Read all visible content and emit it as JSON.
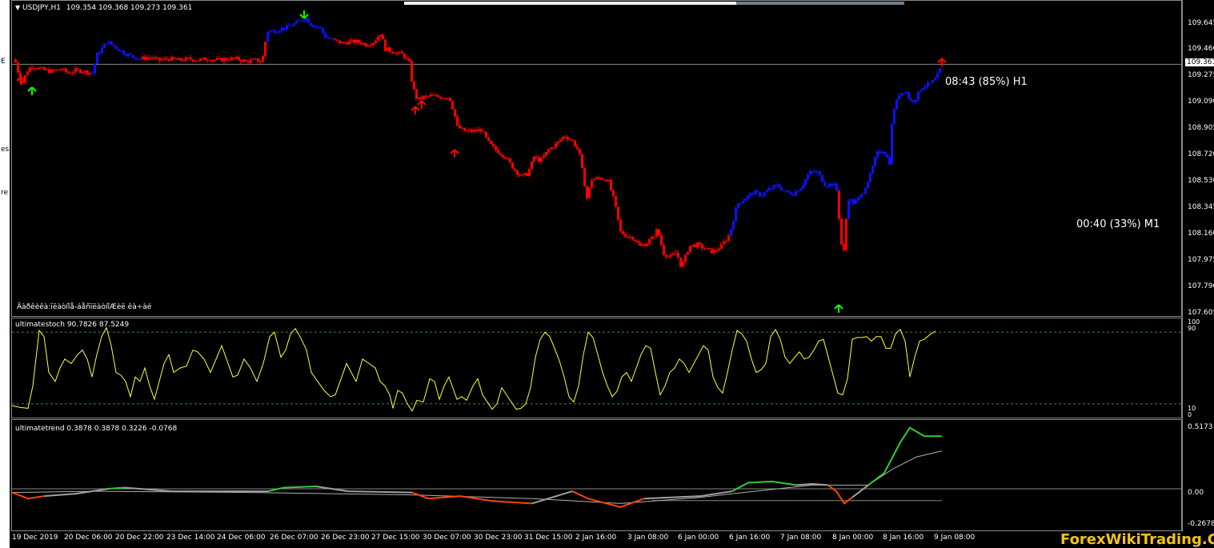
{
  "symbol_info": {
    "label": "USDJPY,H1",
    "ohlc": "109.354 109.368 109.273 109.361",
    "dropdown_icon": "triangle-down-icon"
  },
  "left_strip_glyphs": [
    "E",
    "es",
    "re"
  ],
  "price_axis": {
    "ticks": [
      "109.645",
      "109.460",
      "109.275",
      "109.090",
      "108.905",
      "108.720",
      "108.530",
      "108.345",
      "108.160",
      "107.975",
      "107.790",
      "107.605"
    ],
    "current_price": "109.361"
  },
  "overlays": {
    "timer_h1": "08:43 (85%) H1",
    "timer_m1": "00:40 (33%) M1",
    "garbled_caption": "Äàðêèêà:ïëàòíîå-áåñïëàòíîÆèë êà÷àé"
  },
  "stoch_pane": {
    "title": "ultimatestoch 90.7826 87.5249",
    "ticks": [
      "100",
      "90",
      "10",
      "0"
    ],
    "line_color": "#ffff33"
  },
  "trend_pane": {
    "title": "ultimatetrend 0.3878 0.3878 0.3226 -0.0768",
    "ticks": [
      "0.5173",
      "0.00",
      "-0.2678"
    ],
    "colors": {
      "up": "#33cc33",
      "down": "#ff4500",
      "neutral": "#a0a0a0"
    }
  },
  "time_axis": [
    "19 Dec 2019",
    "20 Dec 06:00",
    "20 Dec 22:00",
    "23 Dec 14:00",
    "24 Dec 06:00",
    "26 Dec 07:00",
    "26 Dec 23:00",
    "27 Dec 15:00",
    "30 Dec 07:00",
    "30 Dec 23:00",
    "31 Dec 15:00",
    "2 Jan 16:00",
    "3 Jan 08:00",
    "6 Jan 00:00",
    "6 Jan 16:00",
    "7 Jan 08:00",
    "8 Jan 00:00",
    "8 Jan 16:00",
    "9 Jan 08:00"
  ],
  "watermark": "ForexWikiTrading.Com",
  "colors": {
    "bull": "#1010ff",
    "bear": "#ff0000",
    "arrow_up": "#00ff00",
    "arrow_down": "#ff0000",
    "background": "#000000",
    "grid_border": "#8a8a8a"
  },
  "price_path": [
    [
      0,
      109.46
    ],
    [
      6,
      109.33
    ],
    [
      12,
      109.22
    ],
    [
      18,
      109.31
    ],
    [
      24,
      109.35
    ],
    [
      30,
      109.34
    ],
    [
      40,
      109.32
    ],
    [
      50,
      109.31
    ],
    [
      60,
      109.33
    ],
    [
      70,
      109.3
    ],
    [
      80,
      109.32
    ],
    [
      90,
      109.31
    ],
    [
      100,
      109.3
    ],
    [
      106,
      109.43
    ],
    [
      112,
      109.47
    ],
    [
      118,
      109.52
    ],
    [
      124,
      109.5
    ],
    [
      132,
      109.47
    ],
    [
      140,
      109.44
    ],
    [
      148,
      109.42
    ],
    [
      160,
      109.4
    ],
    [
      172,
      109.41
    ],
    [
      184,
      109.39
    ],
    [
      196,
      109.4
    ],
    [
      208,
      109.39
    ],
    [
      220,
      109.4
    ],
    [
      232,
      109.39
    ],
    [
      244,
      109.4
    ],
    [
      256,
      109.39
    ],
    [
      268,
      109.4
    ],
    [
      280,
      109.4
    ],
    [
      292,
      109.38
    ],
    [
      304,
      109.39
    ],
    [
      312,
      109.38
    ],
    [
      318,
      109.59
    ],
    [
      330,
      109.6
    ],
    [
      342,
      109.62
    ],
    [
      354,
      109.65
    ],
    [
      366,
      109.69
    ],
    [
      374,
      109.64
    ],
    [
      384,
      109.62
    ],
    [
      392,
      109.55
    ],
    [
      402,
      109.53
    ],
    [
      412,
      109.51
    ],
    [
      422,
      109.52
    ],
    [
      432,
      109.52
    ],
    [
      442,
      109.5
    ],
    [
      452,
      109.52
    ],
    [
      460,
      109.58
    ],
    [
      466,
      109.47
    ],
    [
      476,
      109.45
    ],
    [
      488,
      109.43
    ],
    [
      496,
      109.37
    ],
    [
      500,
      109.21
    ],
    [
      506,
      109.11
    ],
    [
      514,
      109.13
    ],
    [
      524,
      109.14
    ],
    [
      534,
      109.13
    ],
    [
      546,
      109.13
    ],
    [
      552,
      109.02
    ],
    [
      556,
      108.92
    ],
    [
      566,
      108.89
    ],
    [
      576,
      108.89
    ],
    [
      586,
      108.9
    ],
    [
      596,
      108.8
    ],
    [
      606,
      108.75
    ],
    [
      616,
      108.71
    ],
    [
      626,
      108.63
    ],
    [
      636,
      108.57
    ],
    [
      644,
      108.59
    ],
    [
      652,
      108.71
    ],
    [
      660,
      108.68
    ],
    [
      670,
      108.76
    ],
    [
      680,
      108.8
    ],
    [
      690,
      108.86
    ],
    [
      700,
      108.82
    ],
    [
      708,
      108.75
    ],
    [
      714,
      108.55
    ],
    [
      718,
      108.42
    ],
    [
      724,
      108.55
    ],
    [
      734,
      108.56
    ],
    [
      744,
      108.55
    ],
    [
      752,
      108.4
    ],
    [
      760,
      108.18
    ],
    [
      768,
      108.15
    ],
    [
      776,
      108.14
    ],
    [
      784,
      108.08
    ],
    [
      792,
      108.1
    ],
    [
      800,
      108.14
    ],
    [
      806,
      108.2
    ],
    [
      814,
      108.03
    ],
    [
      822,
      108.0
    ],
    [
      830,
      108.04
    ],
    [
      836,
      107.93
    ],
    [
      846,
      108.08
    ],
    [
      856,
      108.09
    ],
    [
      866,
      108.06
    ],
    [
      876,
      108.04
    ],
    [
      886,
      108.08
    ],
    [
      896,
      108.16
    ],
    [
      906,
      108.38
    ],
    [
      916,
      108.42
    ],
    [
      926,
      108.46
    ],
    [
      936,
      108.44
    ],
    [
      946,
      108.48
    ],
    [
      956,
      108.51
    ],
    [
      966,
      108.46
    ],
    [
      976,
      108.45
    ],
    [
      986,
      108.5
    ],
    [
      996,
      108.6
    ],
    [
      1006,
      108.6
    ],
    [
      1016,
      108.51
    ],
    [
      1026,
      108.52
    ],
    [
      1030,
      108.47
    ],
    [
      1034,
      108.22
    ],
    [
      1038,
      107.97
    ],
    [
      1044,
      108.42
    ],
    [
      1052,
      108.38
    ],
    [
      1062,
      108.45
    ],
    [
      1072,
      108.58
    ],
    [
      1080,
      108.73
    ],
    [
      1088,
      108.76
    ],
    [
      1096,
      108.67
    ],
    [
      1100,
      109.02
    ],
    [
      1108,
      109.15
    ],
    [
      1116,
      109.18
    ],
    [
      1122,
      109.1
    ],
    [
      1128,
      109.11
    ],
    [
      1136,
      109.2
    ],
    [
      1146,
      109.22
    ],
    [
      1154,
      109.26
    ],
    [
      1162,
      109.36
    ]
  ],
  "stoch_path": [
    [
      0,
      8
    ],
    [
      10,
      6
    ],
    [
      20,
      5
    ],
    [
      26,
      30
    ],
    [
      34,
      92
    ],
    [
      40,
      85
    ],
    [
      46,
      45
    ],
    [
      54,
      35
    ],
    [
      60,
      50
    ],
    [
      66,
      60
    ],
    [
      74,
      55
    ],
    [
      82,
      65
    ],
    [
      88,
      70
    ],
    [
      94,
      60
    ],
    [
      100,
      40
    ],
    [
      106,
      65
    ],
    [
      112,
      85
    ],
    [
      118,
      95
    ],
    [
      124,
      75
    ],
    [
      130,
      45
    ],
    [
      136,
      42
    ],
    [
      142,
      35
    ],
    [
      148,
      18
    ],
    [
      154,
      40
    ],
    [
      160,
      35
    ],
    [
      166,
      50
    ],
    [
      172,
      30
    ],
    [
      178,
      15
    ],
    [
      184,
      35
    ],
    [
      190,
      55
    ],
    [
      196,
      65
    ],
    [
      202,
      45
    ],
    [
      210,
      50
    ],
    [
      218,
      52
    ],
    [
      226,
      70
    ],
    [
      232,
      68
    ],
    [
      240,
      60
    ],
    [
      248,
      45
    ],
    [
      256,
      62
    ],
    [
      262,
      75
    ],
    [
      268,
      60
    ],
    [
      276,
      40
    ],
    [
      282,
      42
    ],
    [
      290,
      60
    ],
    [
      298,
      50
    ],
    [
      306,
      35
    ],
    [
      314,
      55
    ],
    [
      322,
      85
    ],
    [
      328,
      90
    ],
    [
      336,
      62
    ],
    [
      342,
      70
    ],
    [
      348,
      88
    ],
    [
      354,
      94
    ],
    [
      360,
      85
    ],
    [
      368,
      70
    ],
    [
      374,
      45
    ],
    [
      382,
      35
    ],
    [
      390,
      25
    ],
    [
      398,
      18
    ],
    [
      404,
      20
    ],
    [
      412,
      40
    ],
    [
      418,
      55
    ],
    [
      424,
      45
    ],
    [
      430,
      35
    ],
    [
      438,
      60
    ],
    [
      446,
      55
    ],
    [
      454,
      50
    ],
    [
      460,
      35
    ],
    [
      466,
      30
    ],
    [
      472,
      20
    ],
    [
      476,
      5
    ],
    [
      482,
      25
    ],
    [
      488,
      22
    ],
    [
      494,
      10
    ],
    [
      500,
      2
    ],
    [
      506,
      14
    ],
    [
      514,
      12
    ],
    [
      522,
      38
    ],
    [
      528,
      35
    ],
    [
      534,
      15
    ],
    [
      540,
      30
    ],
    [
      546,
      40
    ],
    [
      552,
      25
    ],
    [
      556,
      15
    ],
    [
      562,
      18
    ],
    [
      568,
      14
    ],
    [
      576,
      30
    ],
    [
      582,
      38
    ],
    [
      588,
      20
    ],
    [
      594,
      12
    ],
    [
      600,
      4
    ],
    [
      606,
      10
    ],
    [
      612,
      28
    ],
    [
      618,
      20
    ],
    [
      624,
      12
    ],
    [
      630,
      4
    ],
    [
      636,
      5
    ],
    [
      642,
      10
    ],
    [
      648,
      28
    ],
    [
      654,
      62
    ],
    [
      660,
      82
    ],
    [
      666,
      90
    ],
    [
      672,
      85
    ],
    [
      678,
      72
    ],
    [
      684,
      58
    ],
    [
      690,
      40
    ],
    [
      696,
      18
    ],
    [
      702,
      12
    ],
    [
      708,
      30
    ],
    [
      714,
      65
    ],
    [
      720,
      90
    ],
    [
      726,
      84
    ],
    [
      732,
      65
    ],
    [
      738,
      45
    ],
    [
      744,
      30
    ],
    [
      750,
      18
    ],
    [
      756,
      24
    ],
    [
      762,
      40
    ],
    [
      768,
      45
    ],
    [
      774,
      35
    ],
    [
      780,
      50
    ],
    [
      786,
      65
    ],
    [
      792,
      75
    ],
    [
      798,
      72
    ],
    [
      804,
      45
    ],
    [
      810,
      20
    ],
    [
      816,
      30
    ],
    [
      822,
      45
    ],
    [
      828,
      50
    ],
    [
      834,
      60
    ],
    [
      840,
      55
    ],
    [
      846,
      45
    ],
    [
      852,
      55
    ],
    [
      858,
      65
    ],
    [
      864,
      75
    ],
    [
      870,
      70
    ],
    [
      876,
      40
    ],
    [
      882,
      28
    ],
    [
      888,
      22
    ],
    [
      894,
      45
    ],
    [
      900,
      70
    ],
    [
      906,
      92
    ],
    [
      912,
      88
    ],
    [
      918,
      80
    ],
    [
      924,
      60
    ],
    [
      930,
      45
    ],
    [
      936,
      48
    ],
    [
      942,
      55
    ],
    [
      948,
      85
    ],
    [
      954,
      93
    ],
    [
      960,
      82
    ],
    [
      966,
      62
    ],
    [
      972,
      55
    ],
    [
      978,
      62
    ],
    [
      984,
      68
    ],
    [
      990,
      60
    ],
    [
      996,
      62
    ],
    [
      1002,
      70
    ],
    [
      1008,
      80
    ],
    [
      1014,
      82
    ],
    [
      1020,
      62
    ],
    [
      1026,
      42
    ],
    [
      1032,
      22
    ],
    [
      1038,
      20
    ],
    [
      1044,
      38
    ],
    [
      1050,
      82
    ],
    [
      1056,
      84
    ],
    [
      1062,
      84
    ],
    [
      1068,
      85
    ],
    [
      1074,
      80
    ],
    [
      1080,
      85
    ],
    [
      1086,
      85
    ],
    [
      1092,
      72
    ],
    [
      1098,
      72
    ],
    [
      1104,
      88
    ],
    [
      1110,
      93
    ],
    [
      1116,
      80
    ],
    [
      1122,
      40
    ],
    [
      1128,
      62
    ],
    [
      1134,
      80
    ],
    [
      1140,
      82
    ],
    [
      1148,
      88
    ],
    [
      1154,
      91
    ]
  ]
}
